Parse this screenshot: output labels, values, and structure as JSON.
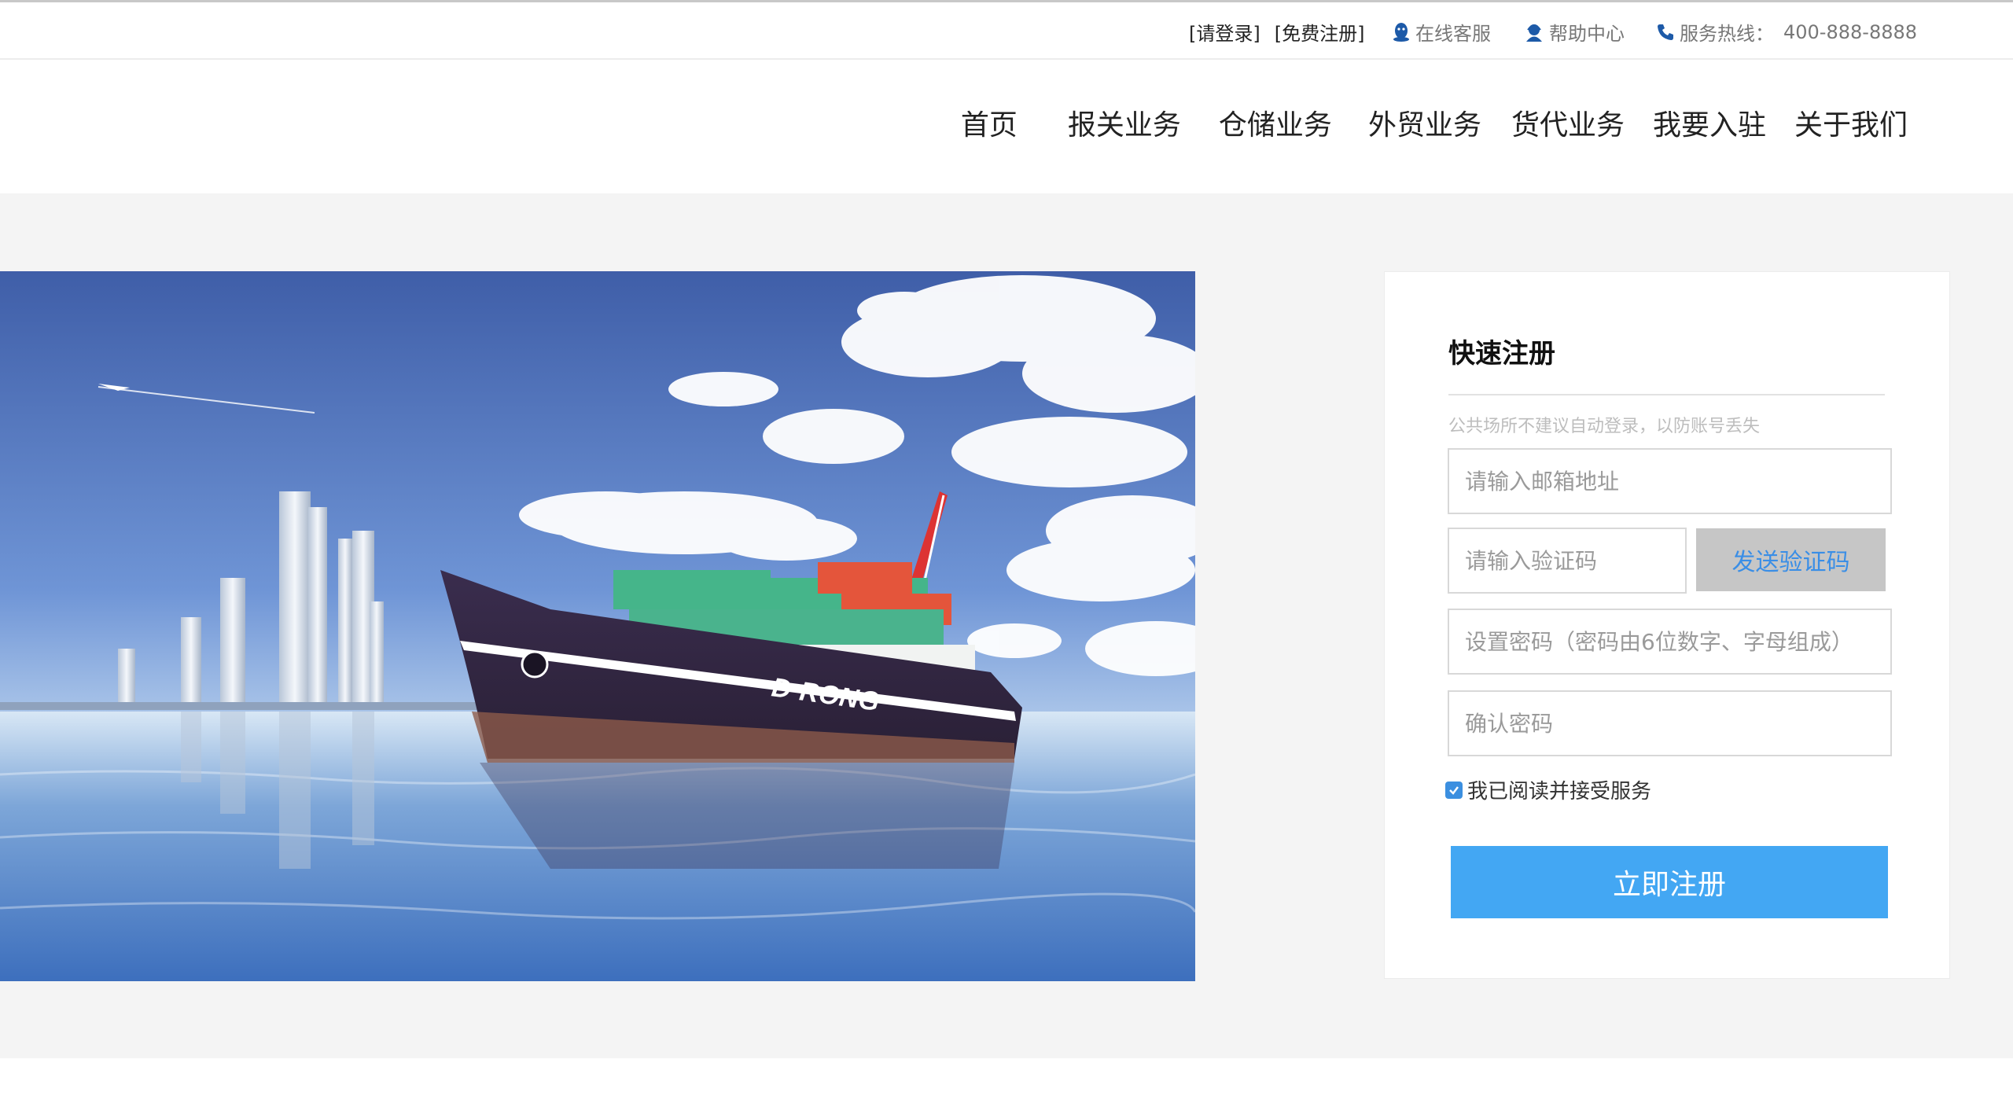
{
  "topbar": {
    "login_link": "[请登录]",
    "register_link": "[免费注册]",
    "online_service": "在线客服",
    "help_center": "帮助中心",
    "hotline_label": "服务热线：",
    "hotline_number": "400-888-8888"
  },
  "nav": {
    "items": [
      "首页",
      "报关业务",
      "仓储业务",
      "外贸业务",
      "货代业务",
      "我要入驻",
      "关于我们"
    ]
  },
  "hero": {
    "ship_brand": "D·RONG"
  },
  "register": {
    "title": "快速注册",
    "hint": "公共场所不建议自动登录，以防账号丢失",
    "email_placeholder": "请输入邮箱地址",
    "code_placeholder": "请输入验证码",
    "send_code_label": "发送验证码",
    "password_placeholder": "设置密码（密码由6位数字、字母组成）",
    "confirm_placeholder": "确认密码",
    "agree_label": "我已阅读并接受服务",
    "agree_checked": true,
    "submit_label": "立即注册"
  },
  "colors": {
    "accent": "#43a7f3",
    "send_text": "#3a8ee6",
    "band_bg": "#f4f4f4"
  },
  "icons": [
    "qq-icon",
    "support-agent-icon",
    "phone-icon",
    "checkbox-checked-icon"
  ]
}
